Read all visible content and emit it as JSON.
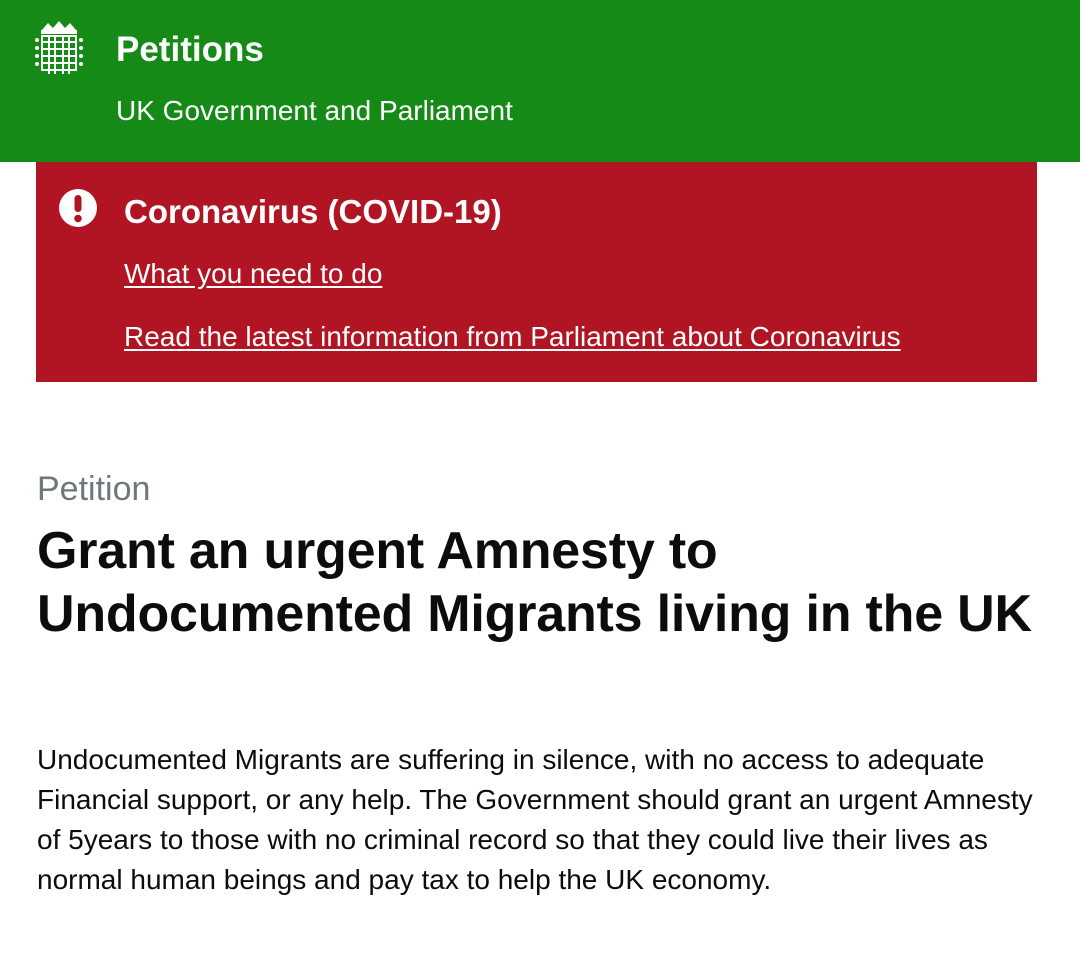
{
  "header": {
    "title": "Petitions",
    "subtitle": "UK Government and Parliament",
    "logo_icon": "portcullis-icon",
    "background_color": "#168a16"
  },
  "alert": {
    "icon": "exclamation-circle-icon",
    "title": "Coronavirus (COVID-19)",
    "links": [
      "What you need to do",
      "Read the latest information from Parliament about Coronavirus"
    ],
    "background_color": "#b11523"
  },
  "petition": {
    "kicker": "Petition",
    "title": "Grant an urgent Amnesty to Undocumented Migrants living in the UK",
    "description": "Undocumented Migrants are suffering in silence, with no access to adequate Financial support, or any help. The Government should grant an urgent Amnesty of 5years to those with no criminal record so that they could live their lives as normal human beings and pay tax to help the UK economy."
  }
}
